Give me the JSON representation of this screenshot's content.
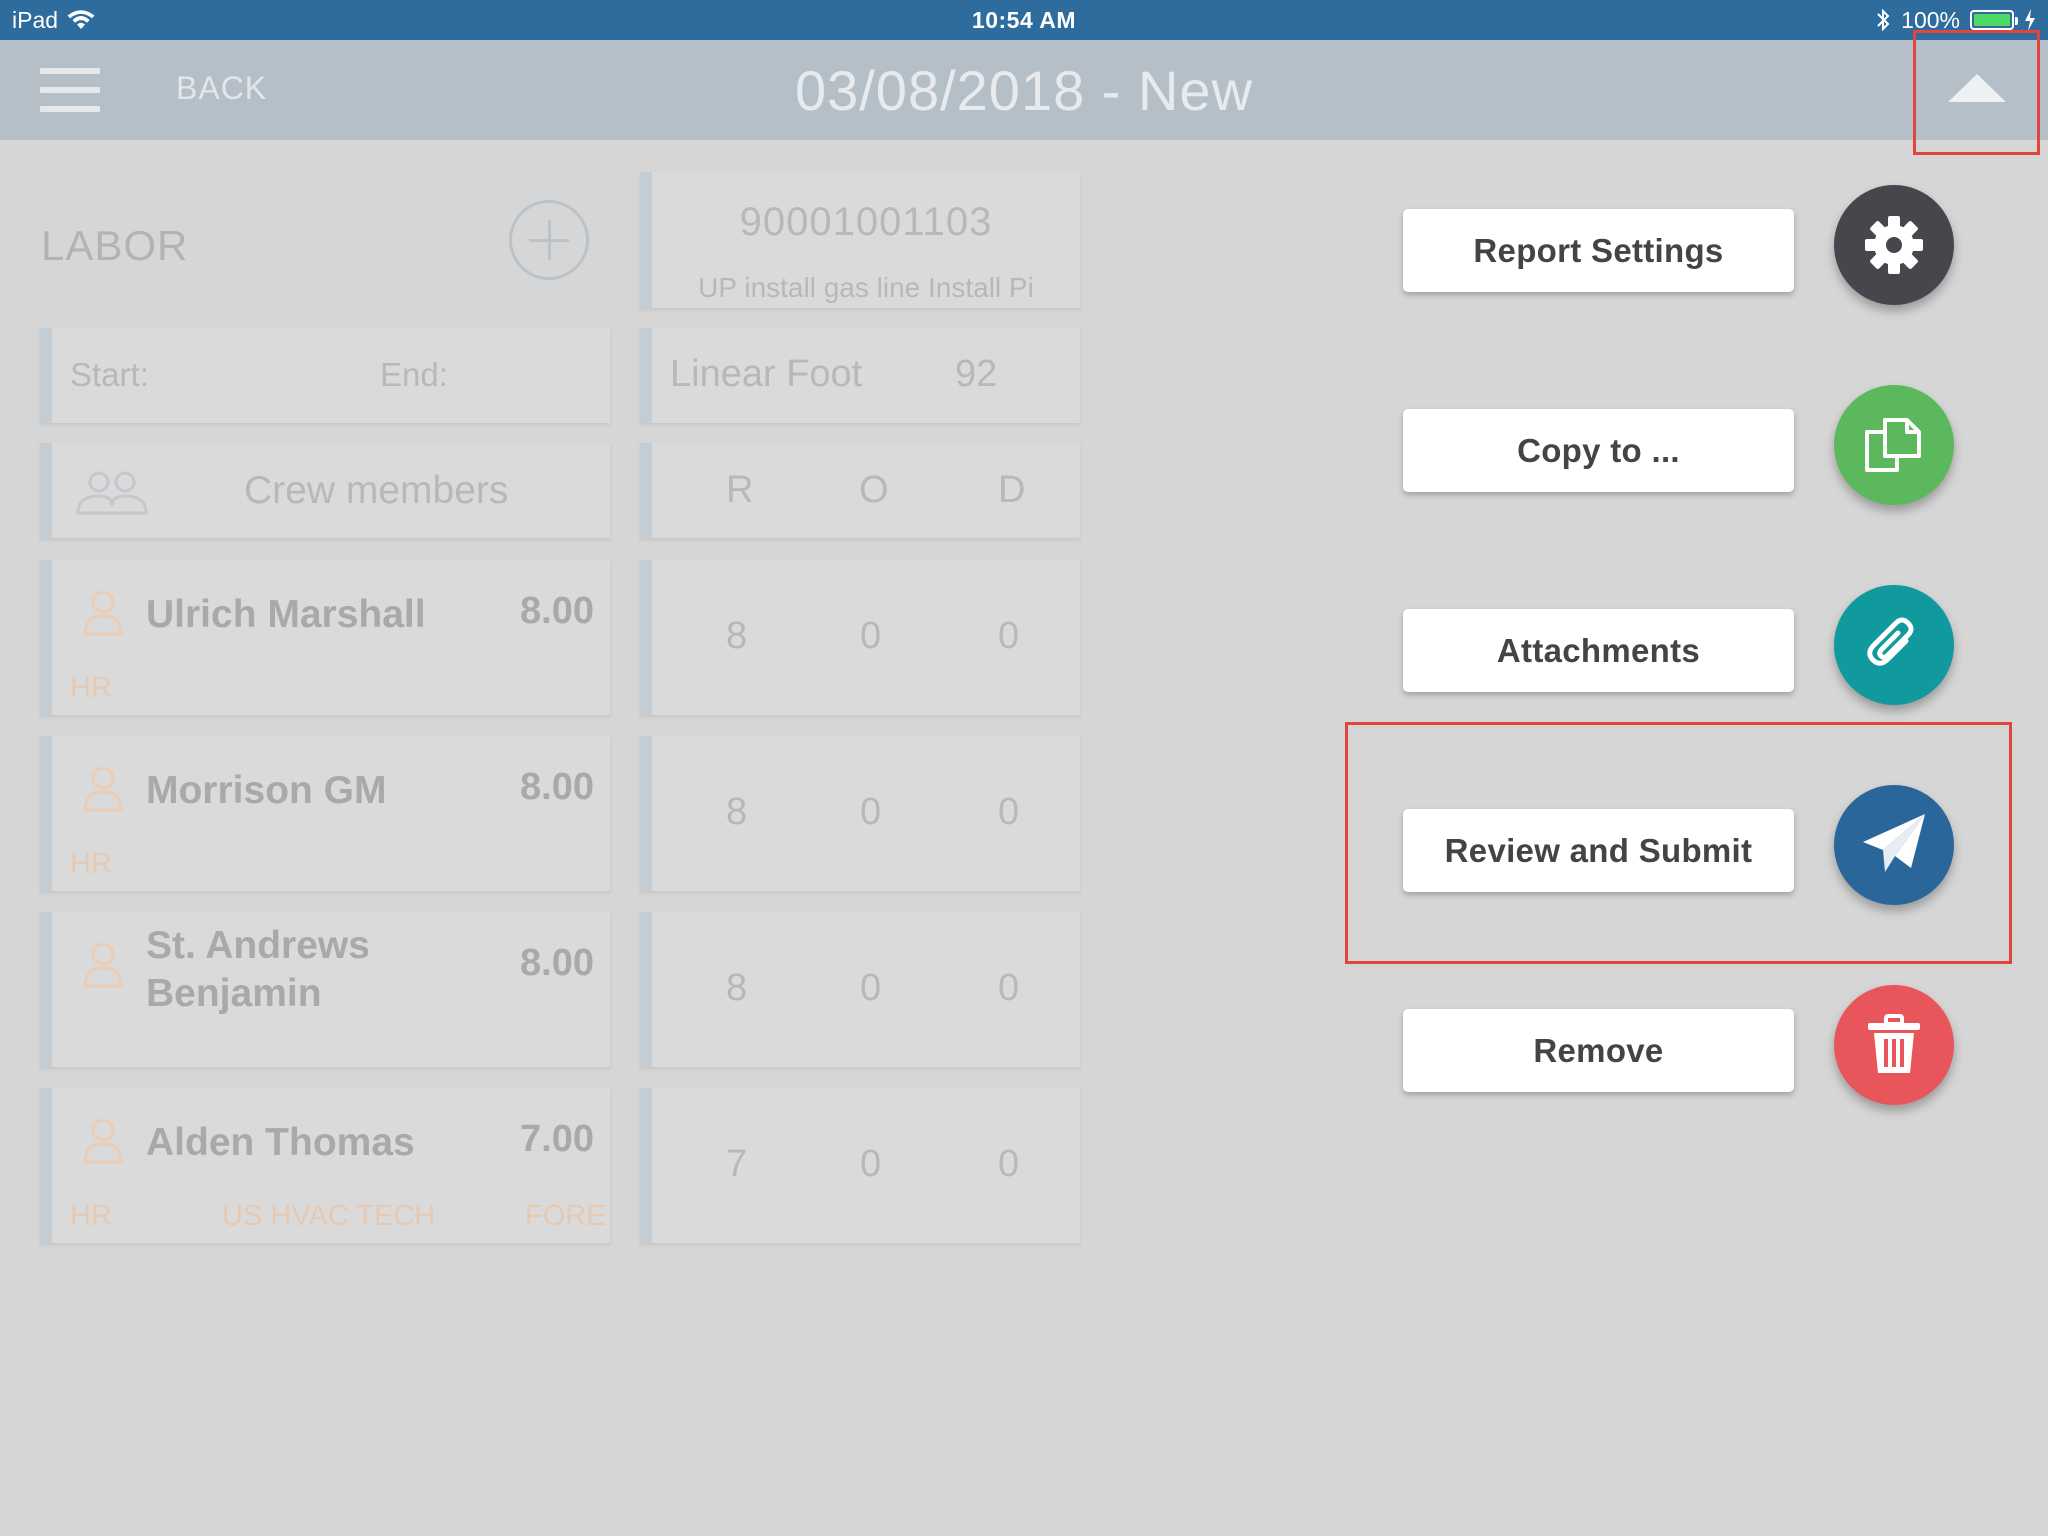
{
  "status_bar": {
    "device": "iPad",
    "time": "10:54 AM",
    "battery": "100%"
  },
  "header": {
    "back_label": "BACK",
    "title": "03/08/2018 - New"
  },
  "labor": {
    "title": "LABOR",
    "job": {
      "number": "90001001103",
      "description": "UP install gas line Install Pi"
    },
    "time_range": {
      "start_label": "Start:",
      "end_label": "End:"
    },
    "quantity": {
      "unit": "Linear Foot",
      "value": "92"
    },
    "crew_label": "Crew members",
    "columns": [
      "R",
      "O",
      "D"
    ],
    "members": [
      {
        "name": "Ulrich Marshall",
        "hours": "8.00",
        "tag": "HR",
        "r": "8",
        "o": "0",
        "d": "0"
      },
      {
        "name": "Morrison GM",
        "hours": "8.00",
        "tag": "HR",
        "r": "8",
        "o": "0",
        "d": "0"
      },
      {
        "name": "St. Andrews Benjamin",
        "hours": "8.00",
        "tag": "",
        "r": "8",
        "o": "0",
        "d": "0"
      },
      {
        "name": "Alden Thomas",
        "hours": "7.00",
        "tag": "HR",
        "trade": "US HVAC TECH",
        "role": "FORE",
        "r": "7",
        "o": "0",
        "d": "0"
      }
    ]
  },
  "actions": [
    {
      "label": "Report Settings",
      "icon": "gear-icon",
      "color": "#45474c"
    },
    {
      "label": "Copy to ...",
      "icon": "copy-icon",
      "color": "#5cb85c"
    },
    {
      "label": "Attachments",
      "icon": "paperclip-icon",
      "color": "#119a9e"
    },
    {
      "label": "Review and Submit",
      "icon": "paper-plane-icon",
      "color": "#2b669a"
    },
    {
      "label": "Remove",
      "icon": "trash-icon",
      "color": "#e8555a"
    }
  ],
  "colors": {
    "status_bar": "#2d6c9c",
    "highlight": "#e2453d"
  }
}
